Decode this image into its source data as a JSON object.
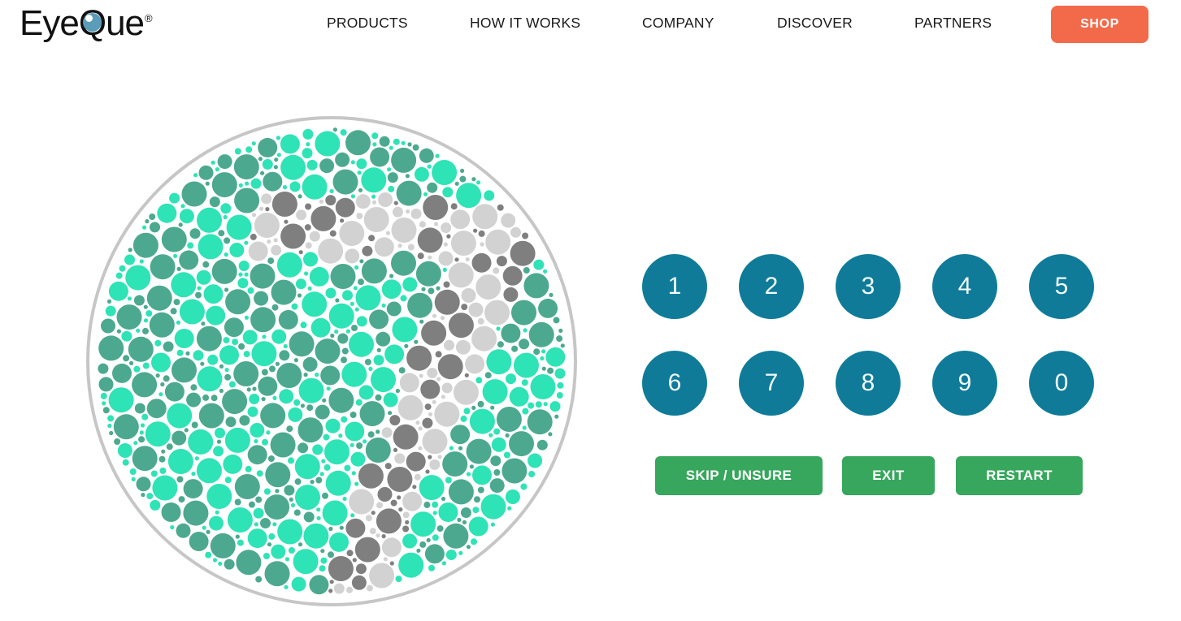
{
  "header": {
    "logo": {
      "name": "EyeQue",
      "text_before_q": "Eye",
      "q_letter": "Q",
      "text_after_q": "ue",
      "registered_mark": "®",
      "iris_color": "#5b9cb9"
    },
    "nav": [
      {
        "id": "products",
        "label": "PRODUCTS"
      },
      {
        "id": "how-it-works",
        "label": "HOW IT WORKS"
      },
      {
        "id": "company",
        "label": "COMPANY"
      },
      {
        "id": "discover",
        "label": "DISCOVER"
      },
      {
        "id": "partners",
        "label": "PARTNERS"
      }
    ],
    "shop_button": {
      "label": "SHOP",
      "color": "#f26a4a",
      "text_color": "#ffffff"
    }
  },
  "test": {
    "plate": {
      "type": "ishihara-color-vision-plate",
      "hidden_digit": "7",
      "ring_color": "#c6c6c6",
      "background": "#ffffff",
      "dot_colors": {
        "bright_green": "#2ee3b6",
        "sea_green": "#4ca98f",
        "dark_gray": "#7f7f7f",
        "light_gray": "#d2d2d2"
      }
    },
    "keypad": {
      "button_color": "#0f7b99",
      "text_color": "#f2fbfd",
      "rows": [
        [
          "1",
          "2",
          "3",
          "4",
          "5"
        ],
        [
          "6",
          "7",
          "8",
          "9",
          "0"
        ]
      ]
    },
    "actions": {
      "color": "#36a75c",
      "text_color": "#ffffff",
      "buttons": [
        {
          "id": "skip",
          "label": "SKIP / UNSURE"
        },
        {
          "id": "exit",
          "label": "EXIT"
        },
        {
          "id": "restart",
          "label": "RESTART"
        }
      ]
    }
  }
}
